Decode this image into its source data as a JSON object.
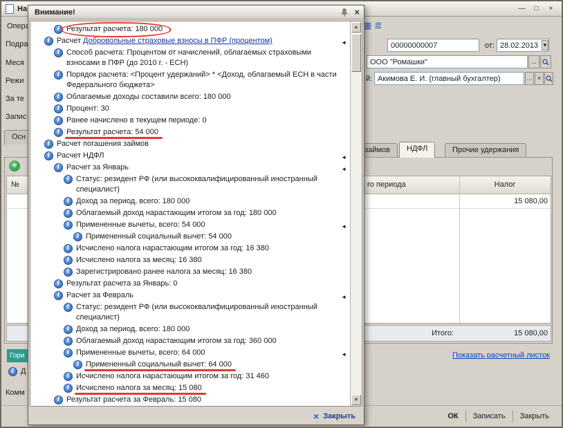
{
  "window": {
    "title_fragment": "На",
    "menu_fragment": "Опера"
  },
  "form": {
    "labels": {
      "l1": "Подра",
      "l2": "Меся",
      "l3": "Режи",
      "l4": "За те",
      "l5": "Запис",
      "tab_fragment": "Осн",
      "responsible_fragment": "й:",
      "comment_fragment": "Комм",
      "info_fragment": "Д",
      "teal_fragment": "Гори"
    },
    "fields": {
      "number": "00000000007",
      "date_label": "от:",
      "date": "28.02.2013",
      "organization": "ООО \"Ромашки\"",
      "responsible": "Акимова Е. И. (главный бухгалтер)"
    },
    "misc": {
      "choose_label": "...",
      "clear_label": "×"
    },
    "tabs": [
      {
        "label": "займов"
      },
      {
        "label": "НДФЛ"
      },
      {
        "label": "Прочие удержания"
      }
    ],
    "table": {
      "number_header": "№",
      "period_header_fragment": "го периода",
      "tax_header": "Налог",
      "tax_value": "15 080,00",
      "total_label": "Итого:",
      "total_value": "15 080,00"
    },
    "payslip_link": "Показать расчетный листок",
    "footer_buttons": {
      "ok": "ОК",
      "save": "Записать",
      "close": "Закрыть"
    }
  },
  "dialog": {
    "title": "Внимание!",
    "close_label": "Закрыть",
    "messages": [
      {
        "indent": 1,
        "text": "Результат расчета: 180 000",
        "mark": "ellipse"
      },
      {
        "indent": 0,
        "prefix": "Расчет ",
        "link": "Добровольные страховые взносы в ПФР (процентом)",
        "arrow": true
      },
      {
        "indent": 1,
        "text": "Способ расчета: Процентом от начислений, облагаемых страховыми взносами в ПФР (до 2010 г. - ЕСН)"
      },
      {
        "indent": 1,
        "text": "Порядок расчета: <Процент удержаний> * <Доход, облагаемый ЕСН в части Федерального бюджета>"
      },
      {
        "indent": 1,
        "text": "Облагаемые доходы составили всего: 180 000"
      },
      {
        "indent": 1,
        "text": "Процент: 30"
      },
      {
        "indent": 1,
        "text": "Ранее начислено в текущем периоде: 0"
      },
      {
        "indent": 1,
        "text": "Результат расчета: 54 000",
        "mark": "underline"
      },
      {
        "indent": 0,
        "text": "Расчет погашения займов"
      },
      {
        "indent": 0,
        "text": "Расчет НДФЛ",
        "arrow": true
      },
      {
        "indent": 1,
        "text": "Расчет за Январь",
        "arrow": true
      },
      {
        "indent": 2,
        "text": "Статус: резидент РФ (или высококвалифицированный иностранный специалист)"
      },
      {
        "indent": 2,
        "text": "Доход за период, всего: 180 000"
      },
      {
        "indent": 2,
        "text": "Облагаемый доход нарастающим итогом за год: 180 000"
      },
      {
        "indent": 2,
        "text": "Примененные вычеты, всего: 54 000",
        "arrow": true
      },
      {
        "indent": 3,
        "text": "Примененный социальный вычет: 54 000"
      },
      {
        "indent": 2,
        "text": "Исчислено налога нарастающим итогом за год: 16 380"
      },
      {
        "indent": 2,
        "text": "Исчислено налога за месяц: 16 380"
      },
      {
        "indent": 2,
        "text": "Зарегистрировано ранее налога за месяц: 16 380"
      },
      {
        "indent": 1,
        "text": "Результат расчета за Январь: 0"
      },
      {
        "indent": 1,
        "text": "Расчет за Февраль",
        "arrow": true
      },
      {
        "indent": 2,
        "text": "Статус: резидент РФ (или высококвалифицированный иностранный специалист)"
      },
      {
        "indent": 2,
        "text": "Доход за период, всего: 180 000"
      },
      {
        "indent": 2,
        "text": "Облагаемый доход нарастающим итогом за год: 360 000"
      },
      {
        "indent": 2,
        "text": "Примененные вычеты, всего: 64 000",
        "arrow": true
      },
      {
        "indent": 3,
        "text": "Примененный социальный вычет: 64 000",
        "mark": "underline"
      },
      {
        "indent": 2,
        "text": "Исчислено налога нарастающим итогом за год: 31 460"
      },
      {
        "indent": 2,
        "text": "Исчислено налога за месяц: 15 080",
        "mark": "underline"
      },
      {
        "indent": 1,
        "text": "Результат расчета за Февраль: 15 080"
      }
    ]
  }
}
